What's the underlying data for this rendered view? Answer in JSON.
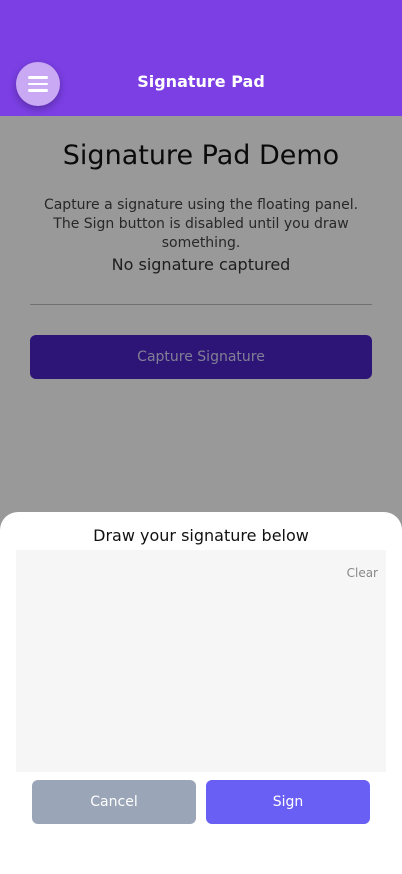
{
  "header": {
    "title": "Signature Pad",
    "menu_icon": "hamburger-menu-icon",
    "background_color": "#7b3fe4"
  },
  "main": {
    "title": "Signature Pad Demo",
    "description": "Capture a signature using the floating panel. The Sign button is disabled until you draw something.",
    "status": "No signature captured",
    "capture_button_label": "Capture Signature"
  },
  "sheet": {
    "title": "Draw your signature below",
    "clear_label": "Clear",
    "cancel_label": "Cancel",
    "sign_label": "Sign"
  },
  "colors": {
    "accent": "#7b3fe4",
    "sign_button": "#6a5ff5",
    "cancel_button": "#9aa6b7"
  }
}
